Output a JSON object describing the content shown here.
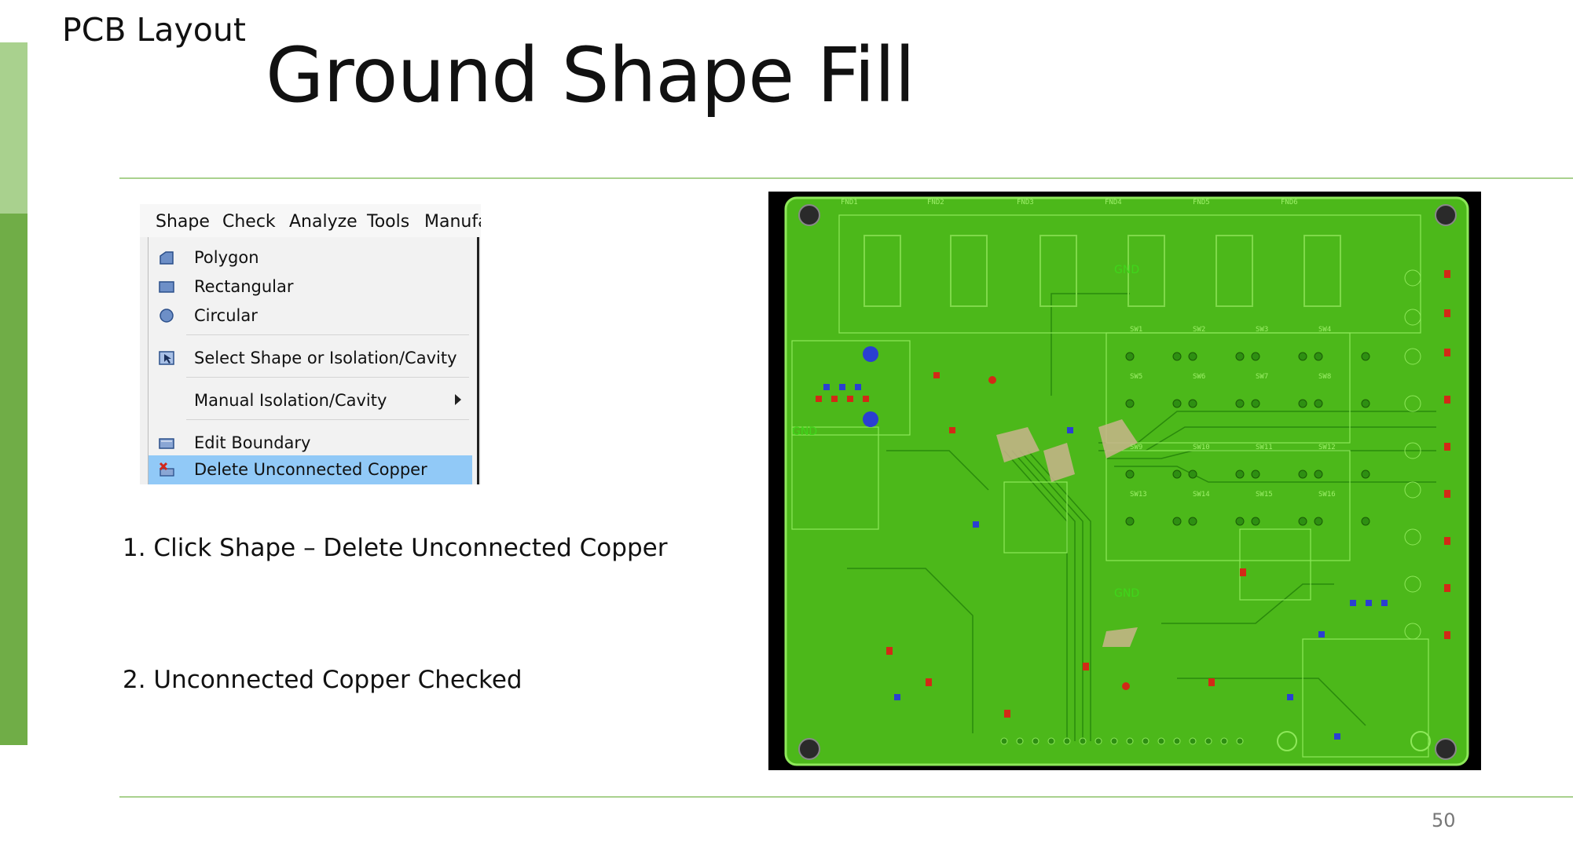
{
  "slide": {
    "section_label": "PCB Layout",
    "title": "Ground Shape Fill",
    "step1": "1. Click Shape – Delete Unconnected Copper",
    "step2": "2. Unconnected Copper Checked",
    "page_number": "50"
  },
  "menu": {
    "menubar": [
      "Shape",
      "Check",
      "Analyze",
      "Tools",
      "Manufa"
    ],
    "items": [
      {
        "label": "Polygon",
        "icon": "polygon-icon"
      },
      {
        "label": "Rectangular",
        "icon": "rectangle-icon"
      },
      {
        "label": "Circular",
        "icon": "circle-icon"
      },
      {
        "label": "Select Shape or Isolation/Cavity",
        "icon": "select-shape-icon"
      },
      {
        "label": "Manual Isolation/Cavity",
        "icon": "submenu-arrow-icon"
      },
      {
        "label": "Edit Boundary",
        "icon": "edit-boundary-icon"
      },
      {
        "label": "Delete Unconnected Copper",
        "icon": "delete-copper-icon",
        "selected": true
      }
    ]
  },
  "pcb": {
    "labels_top": [
      "FND1",
      "FND2",
      "FND3",
      "FND4",
      "FND5",
      "FND6"
    ],
    "switch_labels": [
      "SW1",
      "SW2",
      "SW3",
      "SW4",
      "SW5",
      "SW6",
      "SW7",
      "SW8",
      "SW9",
      "SW10",
      "SW11",
      "SW12",
      "SW13",
      "SW14",
      "SW15",
      "SW16"
    ],
    "net_labels": [
      "GND",
      "GND",
      "GND"
    ],
    "colors": {
      "board": "#3fa815",
      "board_fill": "#4cb81a",
      "trace": "#2a8a0c",
      "outline": "#8ee85a",
      "pad_red": "#d22a16",
      "pad_blue": "#2a3fd2",
      "background": "#000000",
      "menu_highlight": "#91c9f7",
      "accent_dark": "#70ad47",
      "accent_light": "#a9d18e"
    }
  }
}
